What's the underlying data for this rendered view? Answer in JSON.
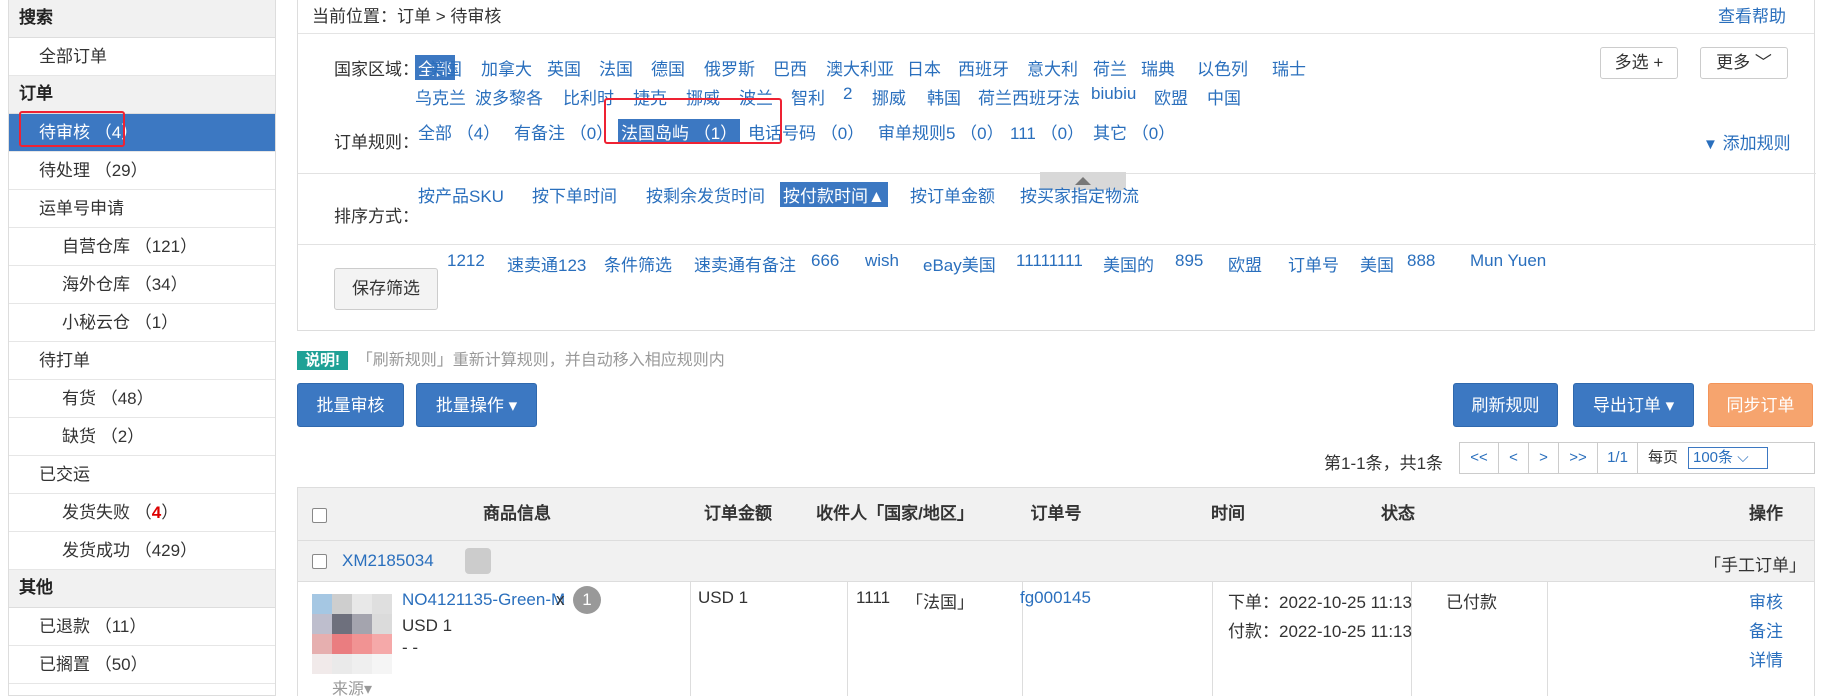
{
  "sidebar": {
    "sections": [
      {
        "head": "搜索",
        "items": [
          {
            "label": "全部订单",
            "sub": false
          }
        ]
      },
      {
        "head": "订单",
        "items": [
          {
            "label": "待审核 （4）",
            "sub": false,
            "active": true
          },
          {
            "label": "待处理 （29）",
            "sub": false
          },
          {
            "label": "运单号申请",
            "sub": false
          },
          {
            "label": "自营仓库 （121）",
            "sub": true
          },
          {
            "label": "海外仓库 （34）",
            "sub": true
          },
          {
            "label": "小秘云仓 （1）",
            "sub": true
          },
          {
            "label": "待打单",
            "sub": false
          },
          {
            "label": "有货 （48）",
            "sub": true
          },
          {
            "label": "缺货 （2）",
            "sub": true
          },
          {
            "label": "已交运",
            "sub": false
          },
          {
            "label": "发货失败 （",
            "sub": true,
            "red": "4",
            "suffix": "）"
          },
          {
            "label": "发货成功 （429）",
            "sub": true
          }
        ]
      },
      {
        "head": "其他",
        "items": [
          {
            "label": "已退款 （11）",
            "sub": false
          },
          {
            "label": "已搁置 （50）",
            "sub": false
          }
        ]
      }
    ]
  },
  "breadcrumb": {
    "prefix": "当前位置：",
    "path": "订单 > 待审核",
    "help": "查看帮助"
  },
  "country": {
    "label": "国家区域：",
    "row1": [
      "全部",
      "美国",
      "加拿大",
      "英国",
      "法国",
      "德国",
      "俄罗斯",
      "巴西",
      "澳大利亚",
      "日本",
      "西班牙",
      "意大利",
      "荷兰",
      "瑞典",
      "以色列",
      "瑞士"
    ],
    "row2": [
      "乌克兰",
      "波多黎各",
      "比利时",
      "捷克",
      "挪威",
      "波兰",
      "智利",
      "2",
      "挪威",
      "韩国",
      "荷兰西班牙法",
      "biubiu",
      "欧盟",
      "中国"
    ],
    "multi": "多选 +",
    "more": "更多 ﹀"
  },
  "rules": {
    "label": "订单规则：",
    "items": [
      "全部 （4）",
      "有备注 （0）",
      "法国岛屿 （1）",
      "电话号码 （0）",
      "审单规则5 （0）",
      "111 （0）",
      "其它 （0）"
    ],
    "add": "添加规则"
  },
  "sort": {
    "label": "排序方式：",
    "items": [
      "按产品SKU",
      "按下单时间",
      "按剩余发货时间",
      "按付款时间▲",
      "按订单金额",
      "按买家指定物流"
    ]
  },
  "saved": {
    "button": "保存筛选",
    "items": [
      "1212",
      "速卖通123",
      "条件筛选",
      "速卖通有备注",
      "666",
      "wish",
      "eBay美国",
      "11111111",
      "美国的",
      "895",
      "欧盟",
      "订单号",
      "美国",
      "888",
      "Mun Yuen"
    ]
  },
  "note": {
    "badge": "说明!",
    "text": "「刷新规则」重新计算规则，并自动移入相应规则内"
  },
  "actions": {
    "batch_review": "批量审核",
    "batch_ops": "批量操作 ▾",
    "refresh": "刷新规则",
    "export": "导出订单 ▾",
    "sync": "同步订单"
  },
  "pager": {
    "summary": "第1-1条，共1条",
    "first": "<<",
    "prev": "<",
    "next": ">",
    "last": ">>",
    "page": "1/1",
    "per_page_label": "每页",
    "per_page": "100条 ⌵"
  },
  "table": {
    "headers": [
      "商品信息",
      "订单金额",
      "收件人「国家/地区」",
      "订单号",
      "时间",
      "状态",
      "操作"
    ],
    "group": {
      "id": "XM2185034",
      "type": "「手工订单」"
    },
    "row": {
      "sku": "NO4121135-Green-M",
      "qty_x": "x",
      "qty": "1",
      "price": "USD 1",
      "dash": "- -",
      "source": "来源▾",
      "amount": "USD 1",
      "recipient": "1111",
      "country": "「法国」",
      "order_no": "fg000145",
      "placed": "下单：2022-10-25 11:13",
      "paid": "付款：2022-10-25 11:13",
      "status": "已付款",
      "op_review": "审核",
      "op_note": "备注",
      "op_detail": "详情"
    }
  }
}
